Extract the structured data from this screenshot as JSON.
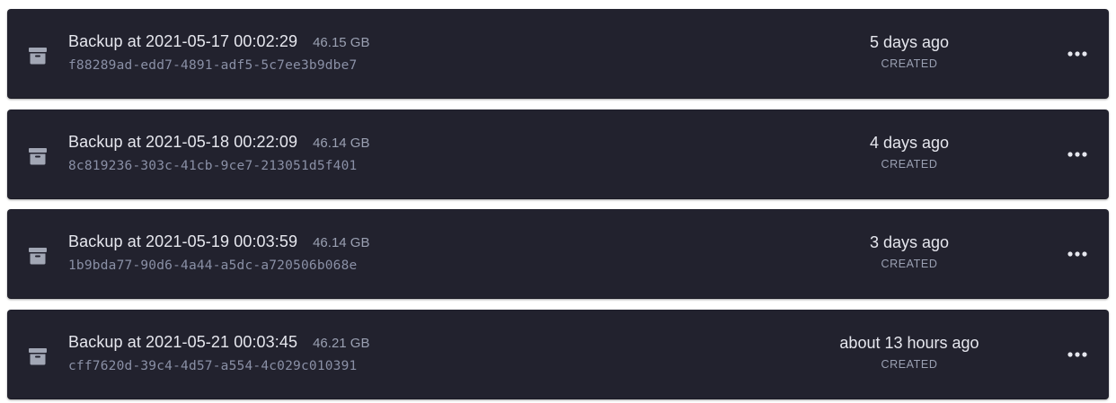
{
  "colors": {
    "row_background": "#22222e",
    "primary_text": "#e6e7ee",
    "secondary_text": "#9aa0b2",
    "icon": "#a2a7b5"
  },
  "backups": [
    {
      "icon": "archive-icon",
      "name": "Backup at 2021-05-17 00:02:29",
      "size": "46.15 GB",
      "uuid": "f88289ad-edd7-4891-adf5-5c7ee3b9dbe7",
      "created_time": "5 days ago",
      "created_label": "CREATED",
      "menu_icon": "ellipsis-icon"
    },
    {
      "icon": "archive-icon",
      "name": "Backup at 2021-05-18 00:22:09",
      "size": "46.14 GB",
      "uuid": "8c819236-303c-41cb-9ce7-213051d5f401",
      "created_time": "4 days ago",
      "created_label": "CREATED",
      "menu_icon": "ellipsis-icon"
    },
    {
      "icon": "archive-icon",
      "name": "Backup at 2021-05-19 00:03:59",
      "size": "46.14 GB",
      "uuid": "1b9bda77-90d6-4a44-a5dc-a720506b068e",
      "created_time": "3 days ago",
      "created_label": "CREATED",
      "menu_icon": "ellipsis-icon"
    },
    {
      "icon": "archive-icon",
      "name": "Backup at 2021-05-21 00:03:45",
      "size": "46.21 GB",
      "uuid": "cff7620d-39c4-4d57-a554-4c029c010391",
      "created_time": "about 13 hours ago",
      "created_label": "CREATED",
      "menu_icon": "ellipsis-icon"
    }
  ]
}
